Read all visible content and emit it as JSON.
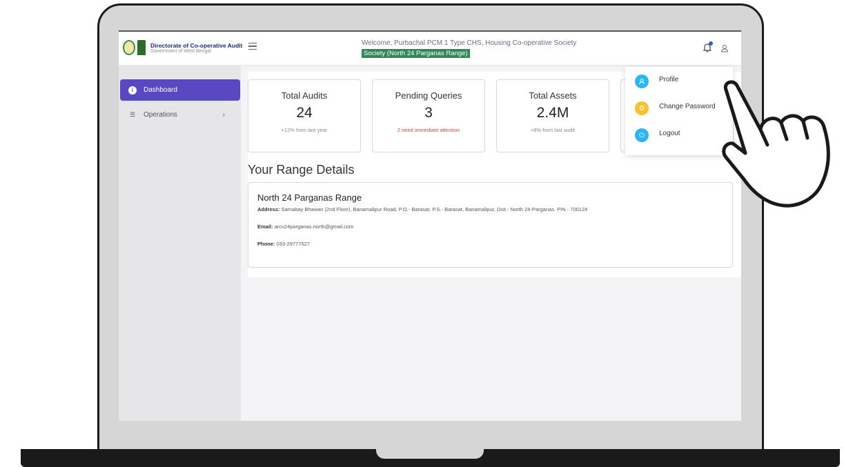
{
  "brand": {
    "title": "Directorate of Co-operative Audit",
    "subtitle": "Government of West Bengal"
  },
  "header": {
    "welcome": "Welcome,  Purbachal PCM 1 Type CHS,  Housing Co-operative Society",
    "society_range": "Society (North 24 Parganas Range)"
  },
  "sidebar": {
    "items": [
      {
        "label": "Dashboard",
        "icon": "info-icon",
        "active": true
      },
      {
        "label": "Operations",
        "icon": "list-icon",
        "active": false
      }
    ]
  },
  "stats": [
    {
      "title": "Total Audits",
      "value": "24",
      "note": "+12% from last year"
    },
    {
      "title": "Pending Queries",
      "value": "3",
      "note": "2 need immediate attention"
    },
    {
      "title": "Total Assets",
      "value": "2.4M",
      "note": "+8% from last audit"
    }
  ],
  "range": {
    "heading": "Your Range Details",
    "name": "North 24 Parganas Range",
    "address_label": "Address:",
    "address": "Samabay Bhawan (2nd Floor), Banamalipur Road, P.O.- Barasat, P.S.- Barasat, Banamalipur, Dist.- North 24-Parganas. PIN - 700124",
    "email_label": "Email:",
    "email": "arcs24parganas.north@gmail.com",
    "phone_label": "Phone:",
    "phone": "033-29777527"
  },
  "dropdown": {
    "items": [
      {
        "label": "Profile",
        "icon": "user-icon",
        "color": "#29b6f6"
      },
      {
        "label": "Change Password",
        "icon": "gear-icon",
        "color": "#fbc02d"
      },
      {
        "label": "Logout",
        "icon": "power-icon",
        "color": "#29b6f6"
      }
    ]
  },
  "colors": {
    "accent": "#5848c2",
    "society_badge": "#2f8a57",
    "alert": "#d64545"
  }
}
